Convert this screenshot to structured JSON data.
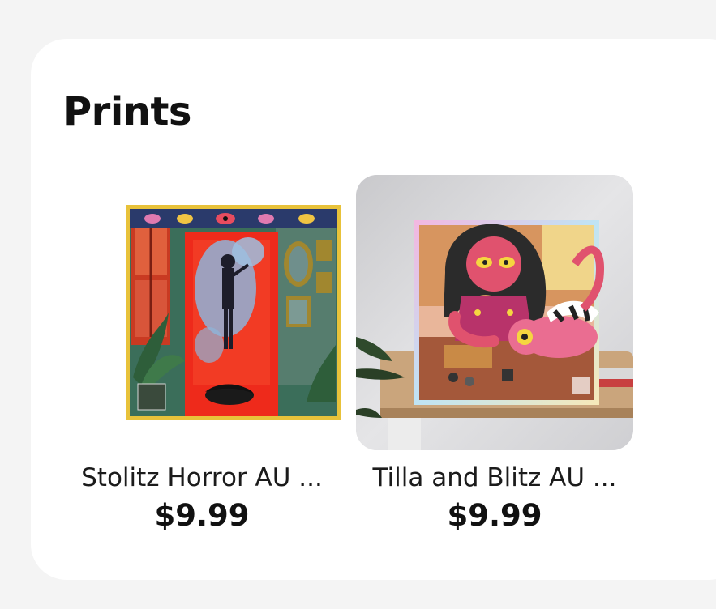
{
  "section": {
    "title": "Prints"
  },
  "products": [
    {
      "name": "Stolitz Horror AU ...",
      "price": "$9.99",
      "image_icon": "horror-au-print-image"
    },
    {
      "name": "Tilla and Blitz AU ...",
      "price": "$9.99",
      "image_icon": "tilla-blitz-print-image"
    }
  ],
  "colors": {
    "page_background": "#f4f4f4",
    "card_background": "#ffffff",
    "text_primary": "#111111"
  }
}
